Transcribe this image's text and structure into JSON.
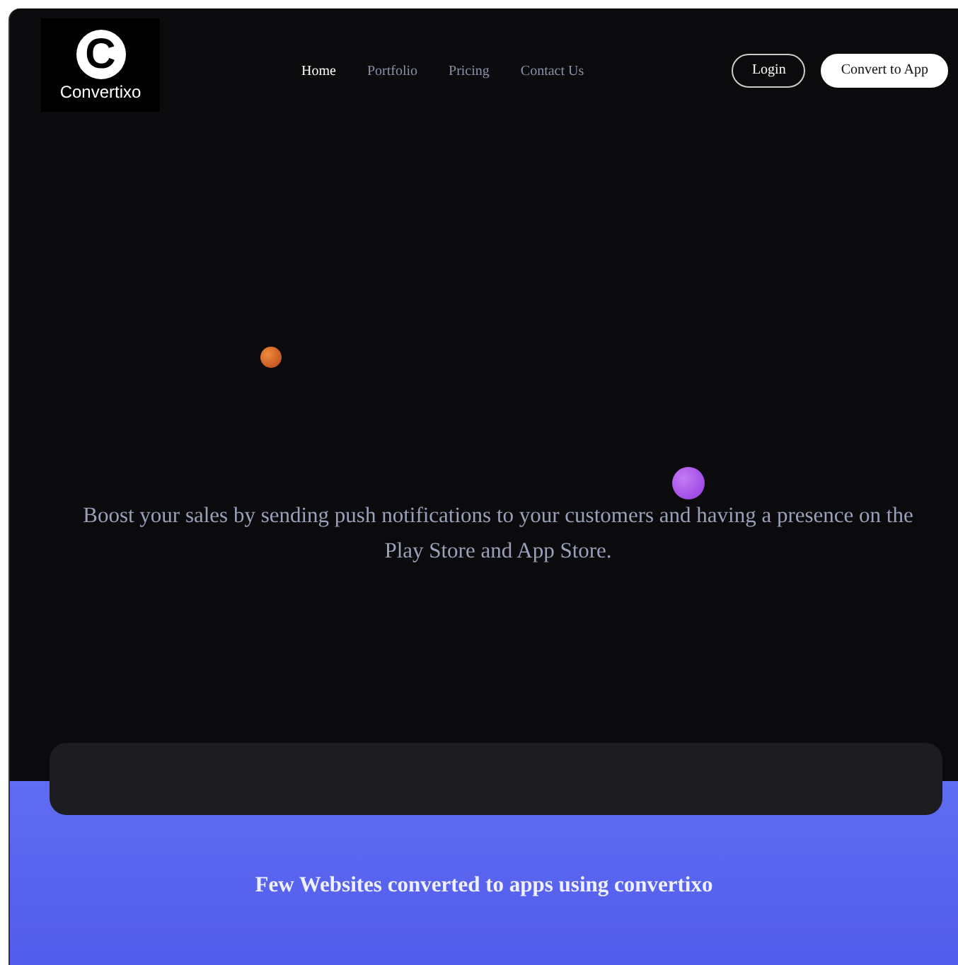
{
  "logo": {
    "letter": "C",
    "name": "Convertixo"
  },
  "nav": [
    {
      "label": "Home",
      "selected": true
    },
    {
      "label": "Portfolio",
      "selected": false
    },
    {
      "label": "Pricing",
      "selected": false
    },
    {
      "label": "Contact Us",
      "selected": false
    }
  ],
  "buttons": [
    {
      "label": "Login",
      "kind": "outline"
    },
    {
      "label": "Convert to App",
      "kind": "solid"
    }
  ],
  "hero": {
    "text": "Boost your sales by sending push notifications to your customers and having a presence on the Play Store and App Store."
  },
  "showcase": {
    "title": "Few Websites converted to apps using convertixo"
  }
}
